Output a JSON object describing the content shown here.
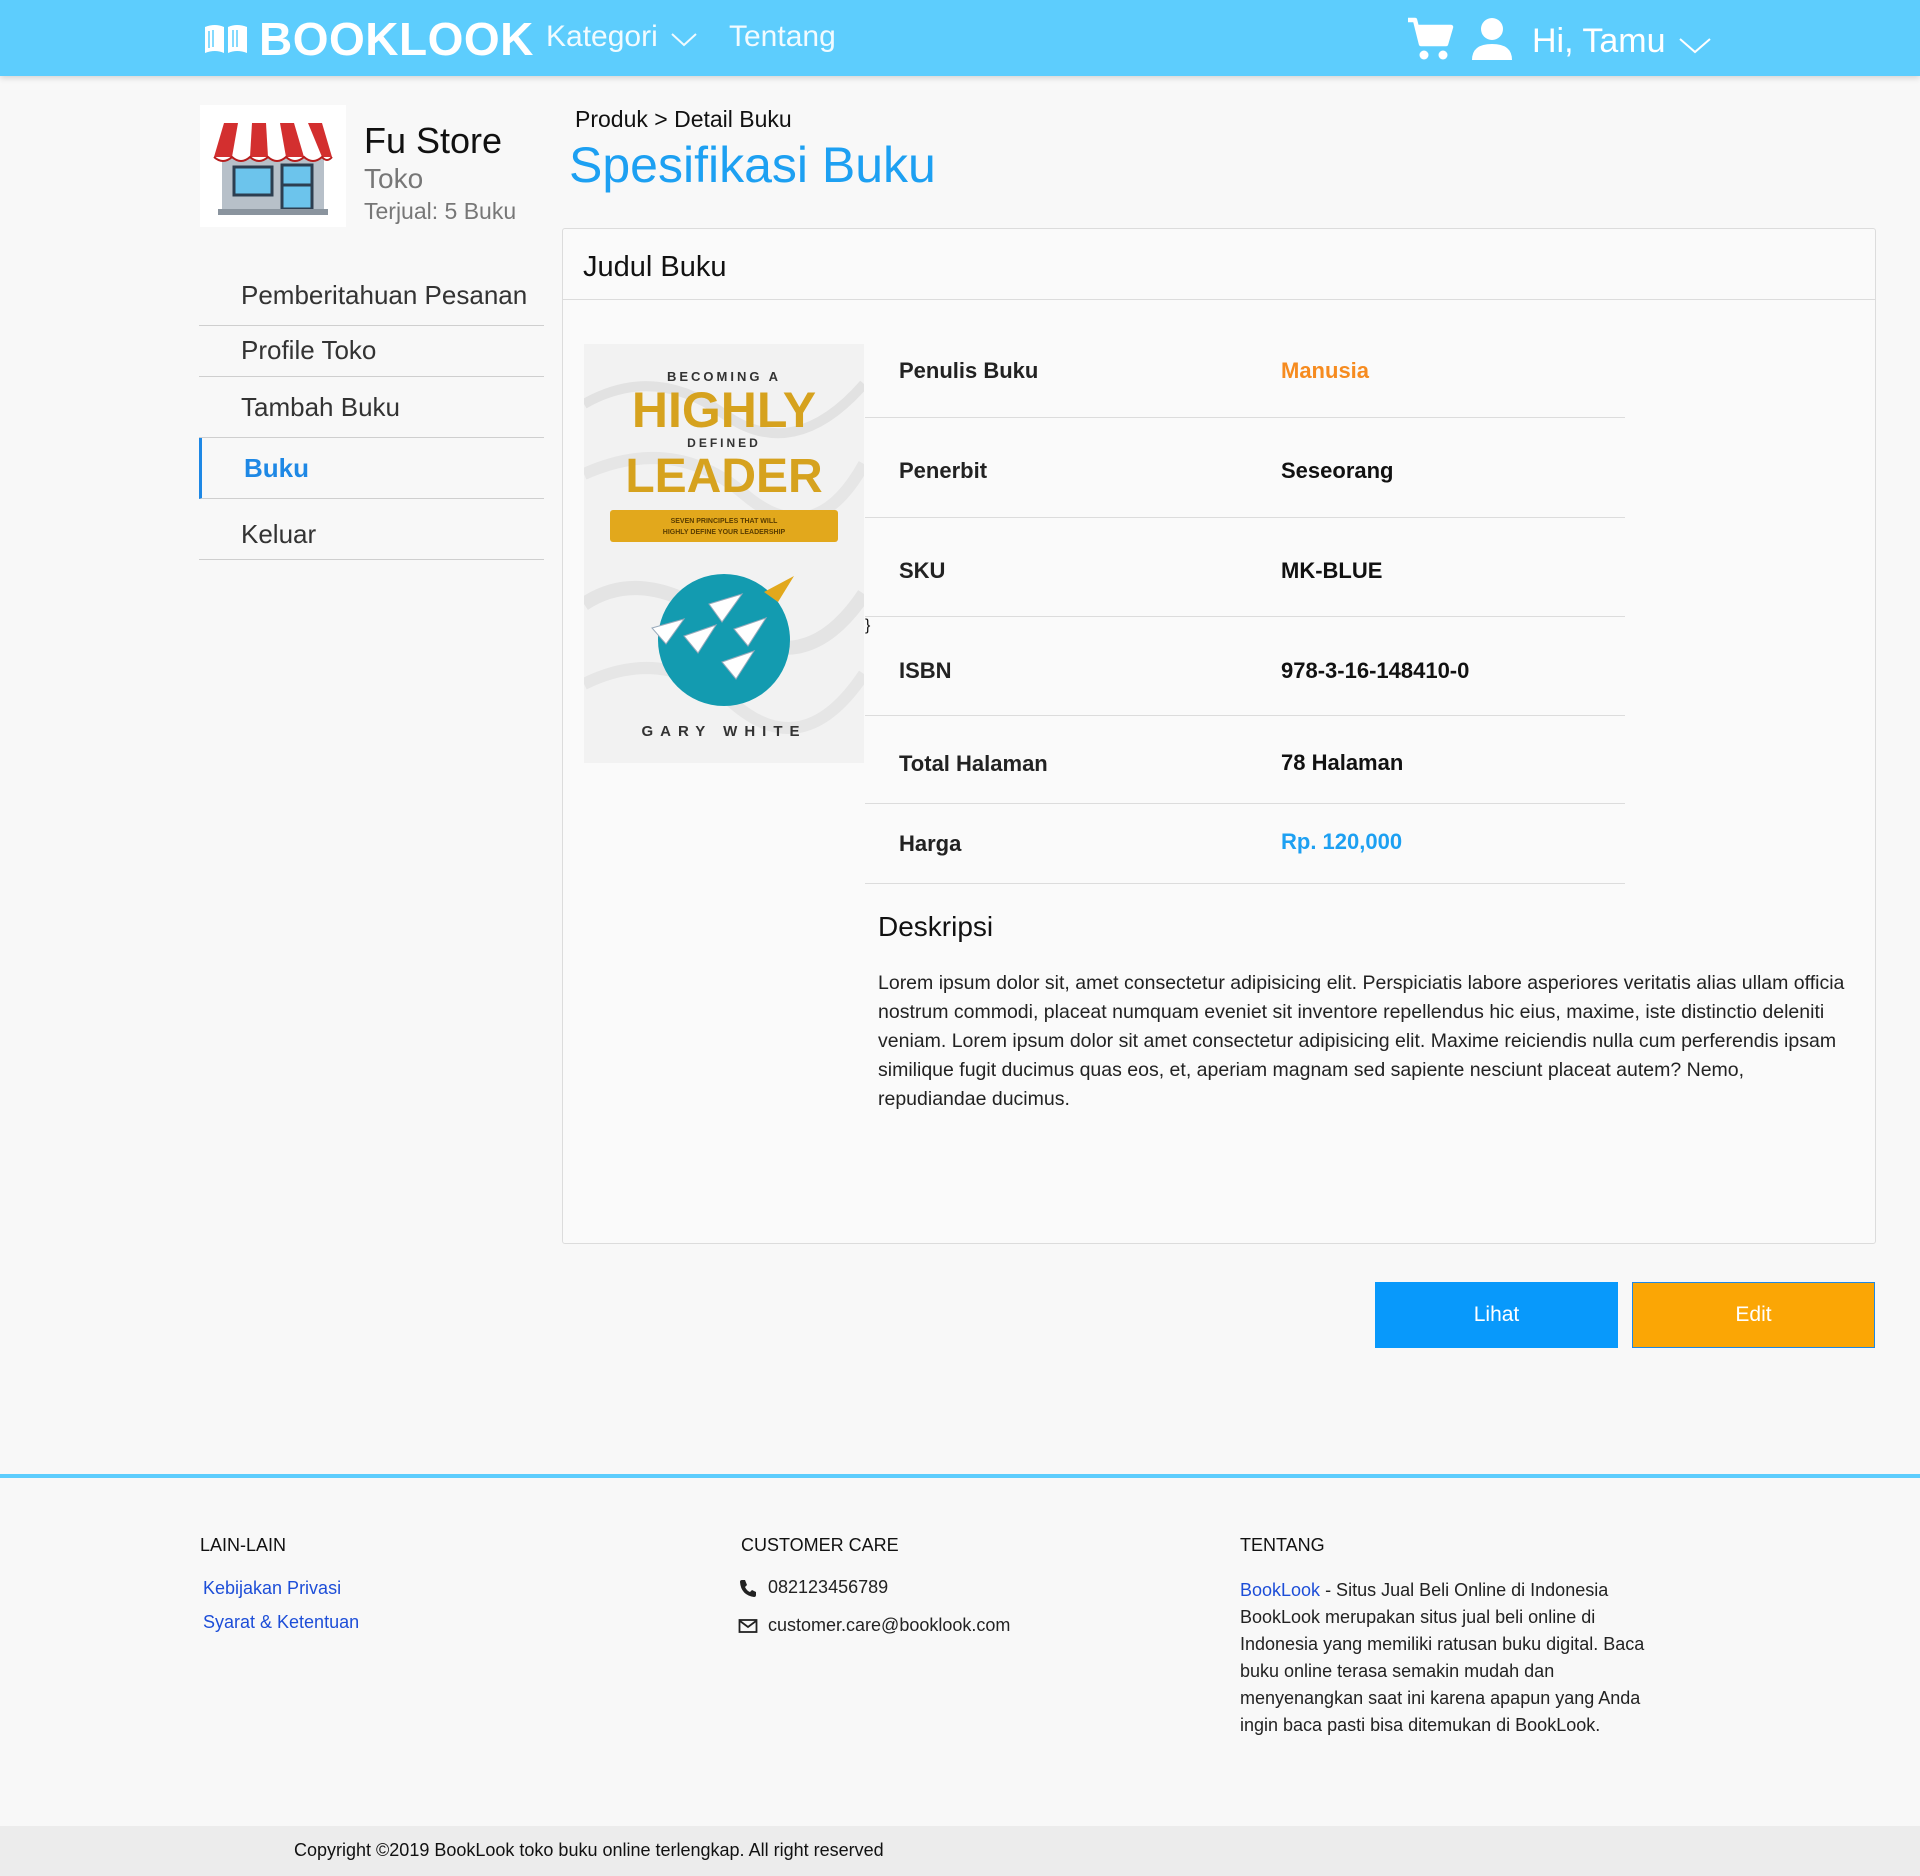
{
  "navbar": {
    "brand": "BOOKLOOK",
    "links": [
      {
        "label": "Kategori"
      },
      {
        "label": "Tentang"
      }
    ],
    "greeting": "Hi, Tamu",
    "bg_color": "#5dcdfd"
  },
  "store": {
    "name": "Fu Store",
    "type": "Toko",
    "sold": "Terjual: 5 Buku"
  },
  "sidebar": {
    "items": [
      {
        "label": "Pemberitahuan Pesanan",
        "active": false
      },
      {
        "label": "Profile Toko",
        "active": false
      },
      {
        "label": "Tambah Buku",
        "active": false
      },
      {
        "label": "Buku",
        "active": true
      },
      {
        "label": "Keluar",
        "active": false
      }
    ]
  },
  "breadcrumb": "Produk > Detail Buku",
  "page_title": "Spesifikasi Buku",
  "book": {
    "card_title": "Judul Buku",
    "cover": {
      "top": "BECOMING A",
      "line1": "HIGHLY",
      "mid": "DEFINED",
      "line2": "LEADER",
      "tagline1": "SEVEN PRINCIPLES THAT WILL",
      "tagline2": "HIGHLY DEFINE YOUR LEADERSHIP",
      "author": "GARY WHITE"
    },
    "specs": [
      {
        "label": "Penulis Buku",
        "value": "Manusia"
      },
      {
        "label": "Penerbit",
        "value": "Seseorang"
      },
      {
        "label": "SKU",
        "value": "MK-BLUE"
      },
      {
        "label": "ISBN",
        "value": "978-3-16-148410-0"
      },
      {
        "label": "Total Halaman",
        "value": "78 Halaman"
      },
      {
        "label": "Harga",
        "value": "Rp. 120,000"
      }
    ],
    "description_title": "Deskripsi",
    "description": "Lorem ipsum dolor sit, amet consectetur adipisicing elit. Perspiciatis labore asperiores veritatis alias ullam  officia nostrum commodi, placeat numquam eveniet sit inventore repellendus hic eius, maxime, iste distinctio deleniti veniam. Lorem ipsum dolor sit amet consectetur adipisicing elit. Maxime reiciendis nulla cum perferendis ipsam similique fugit ducimus quas eos, et, aperiam magnam sed sapiente nesciunt placeat autem? Nemo, repudiandae ducimus."
  },
  "actions": {
    "view_label": "Lihat",
    "edit_label": "Edit",
    "view_color": "#0899fb",
    "edit_color": "#fba605"
  },
  "footer": {
    "col1": {
      "heading": "LAIN-LAIN",
      "links": [
        "Kebijakan Privasi",
        "Syarat & Ketentuan"
      ]
    },
    "col2": {
      "heading": "CUSTOMER CARE",
      "phone": "082123456789",
      "email": "customer.care@booklook.com"
    },
    "col3": {
      "heading": "TENTANG",
      "brand": "BookLook",
      "tagline": " - Situs Jual Beli Online di Indonesia",
      "text": "BookLook merupakan situs jual beli online di Indonesia yang memiliki ratusan buku digital. Baca buku online terasa semakin mudah dan menyenangkan saat ini karena apapun yang Anda ingin baca pasti bisa ditemukan di BookLook."
    },
    "copyright": "Copyright ©2019 BookLook toko buku online terlengkap. All right reserved"
  }
}
